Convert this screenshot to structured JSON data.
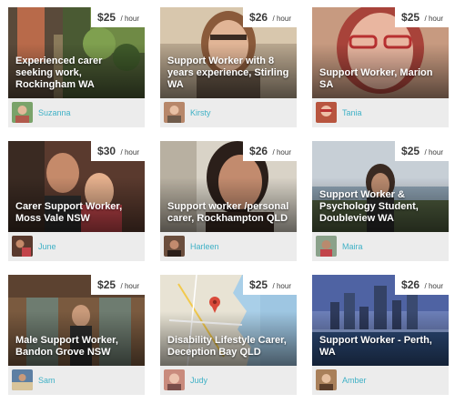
{
  "listings": [
    {
      "title": "Experienced carer seeking work, Rockingham WA",
      "price": "$25",
      "per": "/ hour",
      "user": "Suzanna",
      "avatar_color": "#7aa36a"
    },
    {
      "title": "Support Worker with 8 years experience, Stirling WA",
      "price": "$26",
      "per": "/ hour",
      "user": "Kirsty",
      "avatar_color": "#b7876a"
    },
    {
      "title": "Support Worker, Marion SA",
      "price": "$25",
      "per": "/ hour",
      "user": "Tania",
      "avatar_color": "#b8553f"
    },
    {
      "title": "Carer Support Worker, Moss Vale NSW",
      "price": "$30",
      "per": "/ hour",
      "user": "June",
      "avatar_color": "#c2444a"
    },
    {
      "title": "Support worker /personal carer, Rockhampton QLD",
      "price": "$26",
      "per": "/ hour",
      "user": "Harleen",
      "avatar_color": "#6b4e3d"
    },
    {
      "title": "Support Worker & Psychology Student, Doubleview WA",
      "price": "$25",
      "per": "/ hour",
      "user": "Maira",
      "avatar_color": "#8aa18a"
    },
    {
      "title": "Male Support Worker, Bandon Grove NSW",
      "price": "$25",
      "per": "/ hour",
      "user": "Sam",
      "avatar_color": "#5d7fa3"
    },
    {
      "title": "Disability Lifestyle Carer, Deception Bay QLD",
      "price": "$25",
      "per": "/ hour",
      "user": "Judy",
      "avatar_color": "#c98b7d"
    },
    {
      "title": "Support Worker - Perth, WA",
      "price": "$26",
      "per": "/ hour",
      "user": "Amber",
      "avatar_color": "#a9805a"
    }
  ]
}
